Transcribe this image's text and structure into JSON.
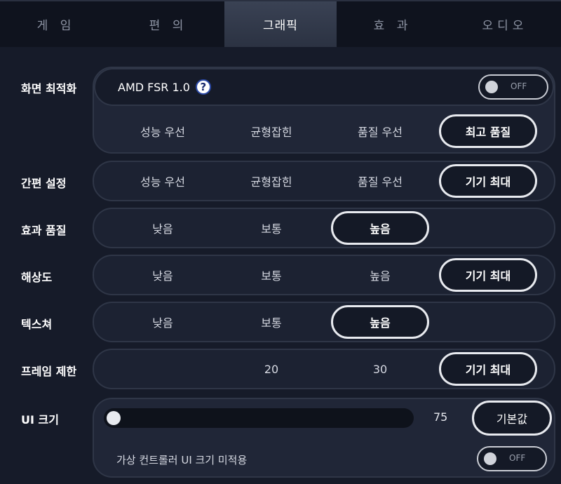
{
  "tabs": [
    "게 임",
    "편 의",
    "그래픽",
    "효 과",
    "오디오"
  ],
  "active_tab": 2,
  "screen_opt": {
    "label": "화면 최적화",
    "feature": "AMD FSR 1.0",
    "help_symbol": "?",
    "toggle": "OFF",
    "options": [
      "성능 우선",
      "균형잡힌",
      "품질 우선",
      "최고 품질"
    ],
    "selected": "최고 품질"
  },
  "simple": {
    "label": "간편 설정",
    "options": [
      "성능 우선",
      "균형잡힌",
      "품질 우선",
      "기기 최대"
    ],
    "selected": "기기 최대"
  },
  "effects": {
    "label": "효과 품질",
    "options": [
      "낮음",
      "보통",
      "높음"
    ],
    "selected": "높음"
  },
  "resolution": {
    "label": "해상도",
    "options": [
      "낮음",
      "보통",
      "높음",
      "기기 최대"
    ],
    "selected": "기기 최대"
  },
  "texture": {
    "label": "텍스쳐",
    "options": [
      "낮음",
      "보통",
      "높음"
    ],
    "selected": "높음"
  },
  "framerate": {
    "label": "프레임 제한",
    "options": [
      "20",
      "30",
      "기기 최대"
    ],
    "selected": "기기 최대"
  },
  "ui_size": {
    "label": "UI 크기",
    "value": "75",
    "default_btn": "기본값",
    "virtual_label": "가상 컨트롤러 UI 크기 미적용",
    "toggle": "OFF"
  }
}
